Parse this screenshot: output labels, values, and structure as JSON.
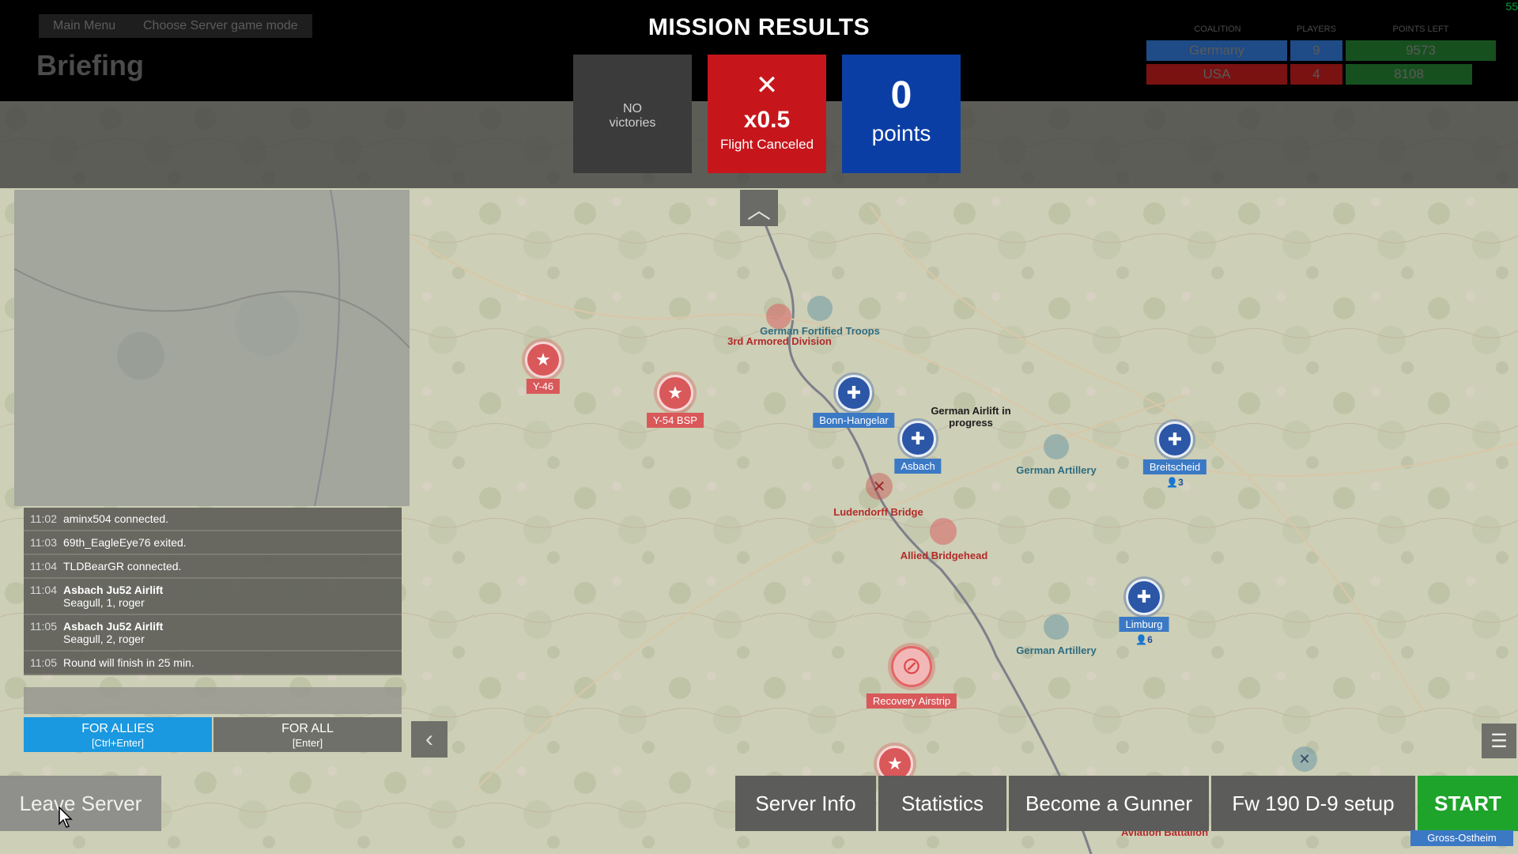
{
  "breadcrumb": [
    "Main Menu",
    "Choose Server game mode"
  ],
  "page_title": "Briefing",
  "mission_results": {
    "title": "MISSION RESULTS",
    "victories_line1": "NO",
    "victories_line2": "victories",
    "penalty_multiplier": "x0.5",
    "penalty_label": "Flight Canceled",
    "points_value": "0",
    "points_label": "points"
  },
  "fps_counter": "55",
  "coalition_table": {
    "headers": [
      "COALITION",
      "PLAYERS",
      "POINTS LEFT"
    ],
    "rows": [
      {
        "name": "Germany",
        "players": "9",
        "points": "9573",
        "color": "#1f4b86"
      },
      {
        "name": "USA",
        "players": "4",
        "points": "8108",
        "color": "#7a1212"
      }
    ]
  },
  "map": {
    "labels": [
      {
        "text": "German Fortified Troops",
        "side": "blue"
      },
      {
        "text": "3rd Armored Division",
        "side": "red"
      },
      {
        "text": "German Airlift in\nprogress",
        "side": "dark"
      },
      {
        "text": "German Artillery",
        "side": "blue"
      },
      {
        "text": "German Artillery",
        "side": "blue"
      },
      {
        "text": "Ludendorff Bridge",
        "side": "red"
      },
      {
        "text": "Allied Bridgehead",
        "side": "red"
      },
      {
        "text": "Aviation Battalion",
        "side": "red"
      }
    ],
    "bases": [
      {
        "name": "Y-46",
        "side": "red",
        "icon": "star-icon"
      },
      {
        "name": "Y-54 BSP",
        "side": "red",
        "icon": "star-icon"
      },
      {
        "name": "Bonn-Hangelar",
        "side": "blue",
        "icon": "iron-cross-icon"
      },
      {
        "name": "Asbach",
        "side": "blue",
        "icon": "iron-cross-icon"
      },
      {
        "name": "Breitscheid",
        "side": "blue",
        "icon": "iron-cross-icon",
        "players": "3"
      },
      {
        "name": "Limburg",
        "side": "blue",
        "icon": "iron-cross-icon",
        "players": "6"
      },
      {
        "name": "Recovery Airstrip",
        "side": "red",
        "icon": "no-entry-icon"
      },
      {
        "name": "Gross-Ostheim",
        "side": "blue",
        "icon": "iron-cross-icon"
      }
    ]
  },
  "chat": {
    "messages": [
      {
        "time": "11:02",
        "text": "aminx504 connected."
      },
      {
        "time": "11:03",
        "text": "69th_EagleEye76 exited."
      },
      {
        "time": "11:04",
        "text": "TLDBearGR connected."
      },
      {
        "time": "11:04",
        "text": "Asbach Ju52 Airlift",
        "text2": "Seagull, 1, roger"
      },
      {
        "time": "11:05",
        "text": "Asbach Ju52 Airlift",
        "text2": "Seagull, 2, roger"
      },
      {
        "time": "11:05",
        "text": "Round will finish in 25 min."
      }
    ],
    "btn_allies": "FOR ALLIES",
    "btn_allies_hint": "[Ctrl+Enter]",
    "btn_all": "FOR ALL",
    "btn_all_hint": "[Enter]"
  },
  "bottom_bar": {
    "leave": "Leave Server",
    "server_info": "Server Info",
    "statistics": "Statistics",
    "gunner": "Become a Gunner",
    "setup": "Fw 190 D-9 setup",
    "start": "START"
  },
  "colors": {
    "penalty_red": "#c6161c",
    "points_blue": "#0b3ea5",
    "start_green": "#1ea42a",
    "allies_blue": "#1a98e0"
  }
}
